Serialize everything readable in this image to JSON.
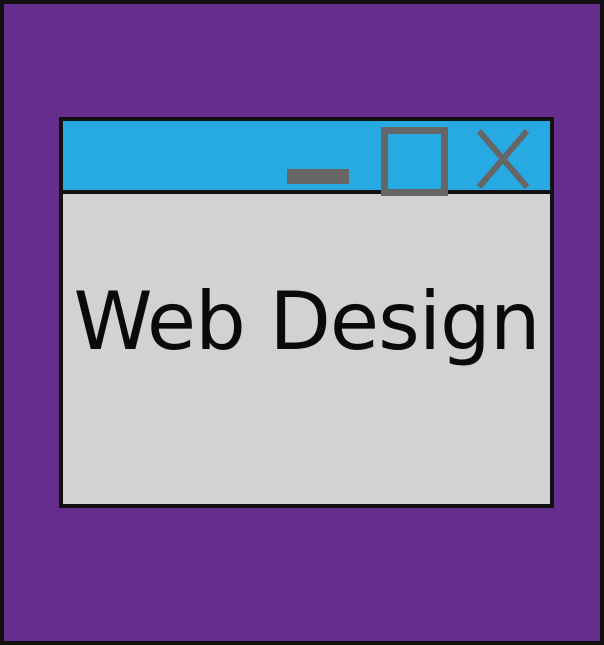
{
  "window": {
    "controls": {
      "minimize_icon": "minimize-icon",
      "maximize_icon": "maximize-icon",
      "close_icon": "close-icon"
    },
    "content": {
      "heading": "Web Design"
    }
  },
  "colors": {
    "background": "#652D8E",
    "titlebar": "#27AAE1",
    "window_body": "#D1D2D4",
    "control_gray": "#666666",
    "border": "#111111"
  }
}
